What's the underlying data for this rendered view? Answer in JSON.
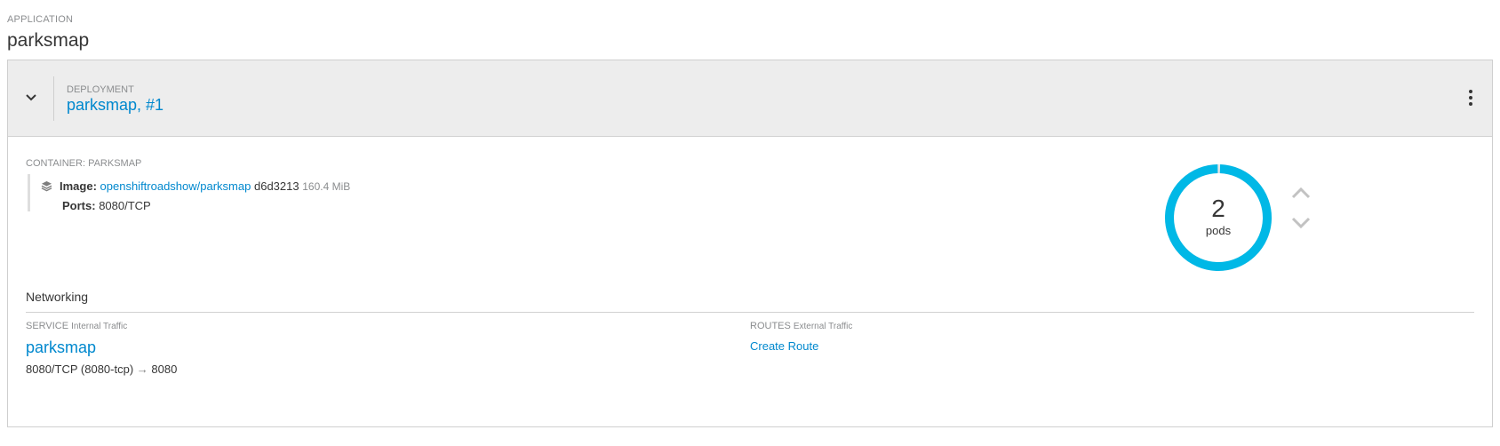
{
  "application": {
    "caption": "APPLICATION",
    "name": "parksmap"
  },
  "deployment": {
    "caption": "DEPLOYMENT",
    "name": "parksmap, #1"
  },
  "container": {
    "caption": "CONTAINER: PARKSMAP",
    "image_label": "Image:",
    "image_link": "openshiftroadshow/parksmap",
    "image_id": "d6d3213",
    "image_size": "160.4 MiB",
    "ports_label": "Ports:",
    "ports_value": "8080/TCP"
  },
  "pods": {
    "count": "2",
    "label": "pods",
    "ring_color": "#00b8e6",
    "fill_fraction": 1.0
  },
  "networking": {
    "title": "Networking",
    "service_caption": "SERVICE",
    "service_sub": "Internal Traffic",
    "service_name": "parksmap",
    "service_port": "8080/TCP (8080-tcp)",
    "service_arrow": "→",
    "service_target": "8080",
    "routes_caption": "ROUTES",
    "routes_sub": "External Traffic",
    "create_route": "Create Route"
  },
  "colors": {
    "link": "#0088ce",
    "header_bg": "#ededed",
    "muted": "#8b8d8f"
  },
  "icons": {
    "collapse": "chevron-down-icon",
    "menu": "kebab-icon",
    "image": "layers-icon",
    "scale_up": "chevron-up-icon",
    "scale_down": "chevron-down-icon"
  }
}
